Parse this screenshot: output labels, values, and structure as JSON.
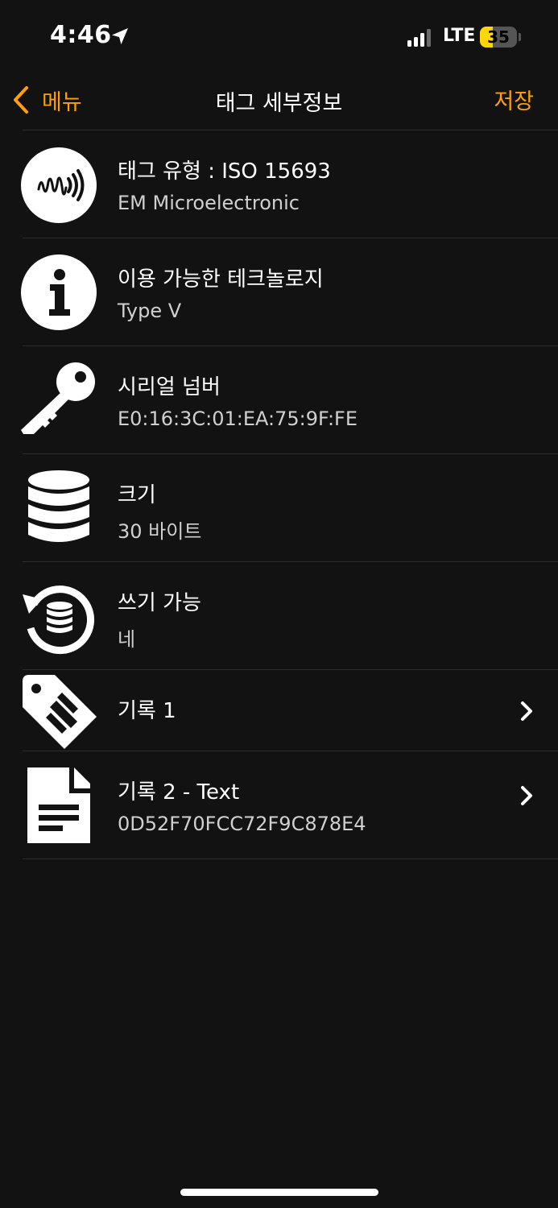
{
  "status_bar": {
    "time": "4:46",
    "network": "LTE",
    "battery_level": "35",
    "battery_color": "#ffd60a"
  },
  "nav": {
    "back_label": "메뉴",
    "title": "태그 세부정보",
    "save_label": "저장",
    "accent_color": "#ff9f0a"
  },
  "rows": [
    {
      "icon": "nfc-wave-icon",
      "title": "태그 유형 : ISO 15693",
      "subtitle": "EM Microelectronic"
    },
    {
      "icon": "info-icon",
      "title": "이용 가능한 테크놀로지",
      "subtitle": "Type V"
    },
    {
      "icon": "key-icon",
      "title": "시리얼 넘버",
      "subtitle": "E0:16:3C:01:EA:75:9F:FE"
    },
    {
      "icon": "database-icon",
      "title": "크기",
      "subtitle": "30 바이트"
    },
    {
      "icon": "writable-database-icon",
      "title": "쓰기 가능",
      "subtitle": "네"
    },
    {
      "icon": "tag-icon",
      "title": "기록 1",
      "subtitle": ""
    },
    {
      "icon": "document-icon",
      "title": "기록 2 - Text",
      "subtitle": "0D52F70FCC72F9C878E4"
    }
  ]
}
